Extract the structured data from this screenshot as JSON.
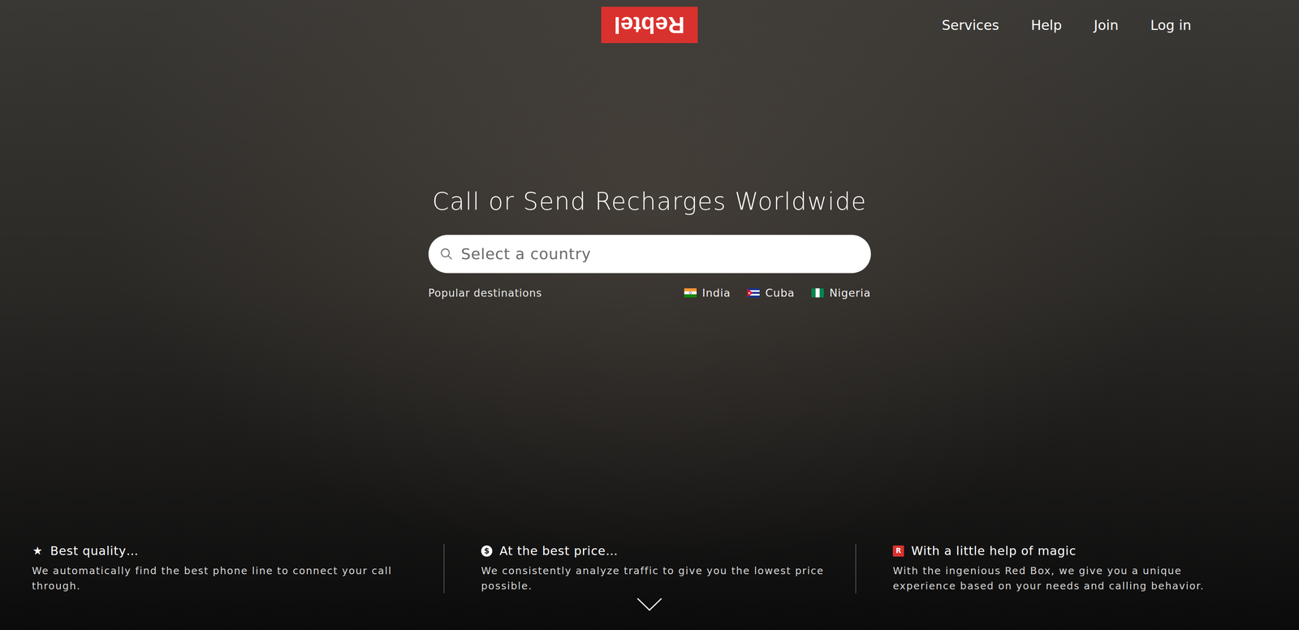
{
  "header": {
    "logo": "Rebtel",
    "nav": [
      "Services",
      "Help",
      "Join",
      "Log in"
    ]
  },
  "hero": {
    "title": "Call or Send Recharges Worldwide",
    "search": {
      "placeholder": "Select a country"
    },
    "popular": {
      "label": "Popular destinations",
      "destinations": [
        {
          "label": "India",
          "kind": "india"
        },
        {
          "label": "Cuba",
          "kind": "cuba"
        },
        {
          "label": "Nigeria",
          "kind": "nigeria"
        }
      ]
    }
  },
  "features": [
    {
      "kind": "star",
      "icon": "★",
      "title": "Best quality…",
      "description": "We automatically find the best phone line to connect your call through."
    },
    {
      "kind": "price",
      "icon": "$",
      "title": "At the best price…",
      "description": "We consistently analyze traffic to give you the lowest price possible."
    },
    {
      "kind": "box",
      "icon": "R",
      "title": "With a little help of magic",
      "description": "With the ingenious Red Box, we give you a unique experience based on your needs and calling behavior."
    }
  ]
}
